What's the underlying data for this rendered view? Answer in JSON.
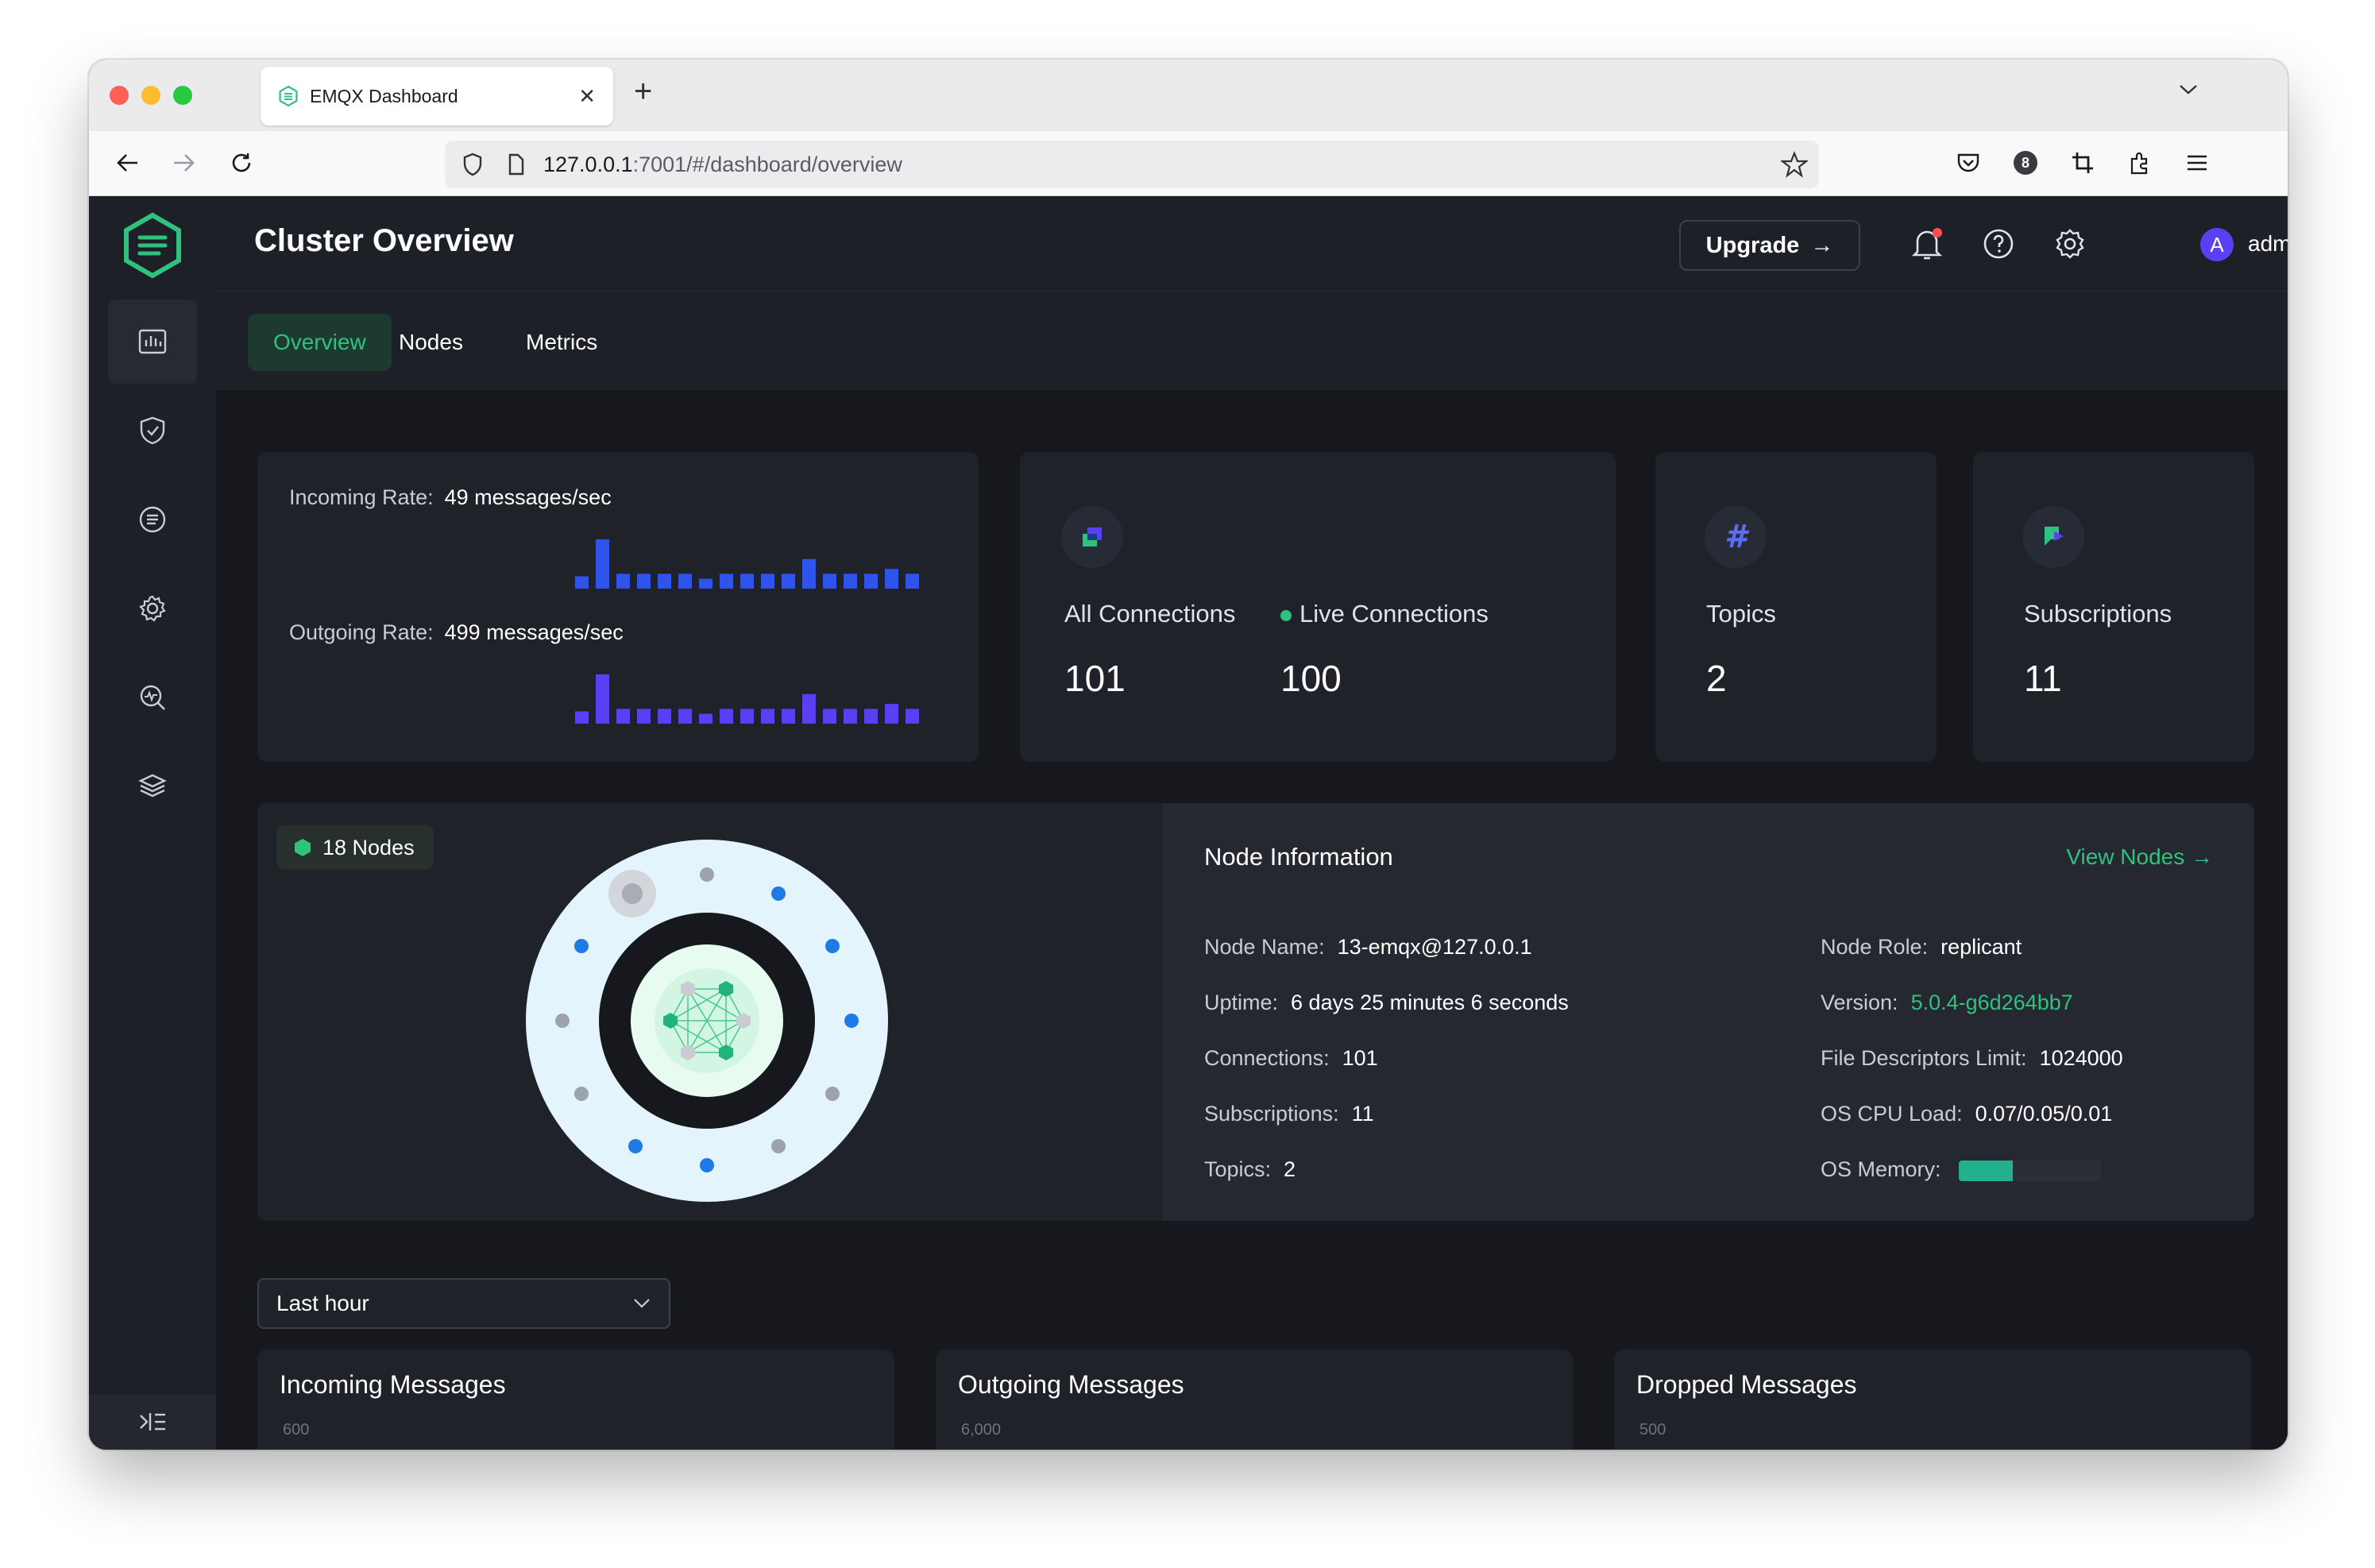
{
  "browser": {
    "tab_title": "EMQX Dashboard",
    "url_host": "127.0.0.1",
    "url_rest": ":7001/#/dashboard/overview",
    "extension_badge": "8"
  },
  "header": {
    "title": "Cluster Overview",
    "upgrade_label": "Upgrade",
    "user_initial": "A",
    "user_name": "admin"
  },
  "tabs": [
    {
      "label": "Overview",
      "active": true
    },
    {
      "label": "Nodes",
      "active": false
    },
    {
      "label": "Metrics",
      "active": false
    }
  ],
  "rates": {
    "incoming_label": "Incoming Rate:",
    "incoming_value": "49 messages/sec",
    "incoming_bars": [
      0.25,
      1.0,
      0.3,
      0.3,
      0.3,
      0.3,
      0.2,
      0.3,
      0.3,
      0.3,
      0.3,
      0.6,
      0.3,
      0.3,
      0.3,
      0.4,
      0.3
    ],
    "outgoing_label": "Outgoing Rate:",
    "outgoing_value": "499 messages/sec",
    "outgoing_bars": [
      0.25,
      1.0,
      0.3,
      0.3,
      0.3,
      0.3,
      0.2,
      0.3,
      0.3,
      0.3,
      0.3,
      0.6,
      0.3,
      0.3,
      0.3,
      0.4,
      0.3
    ],
    "incoming_color": "#2f54eb",
    "outgoing_color": "#5b3ff5"
  },
  "stats": {
    "all_connections_label": "All Connections",
    "all_connections_value": "101",
    "live_connections_label": "Live Connections",
    "live_connections_value": "100",
    "topics_label": "Topics",
    "topics_value": "2",
    "subscriptions_label": "Subscriptions",
    "subscriptions_value": "11"
  },
  "nodes": {
    "badge": "18 Nodes",
    "info_title": "Node Information",
    "view_nodes": "View Nodes",
    "left": [
      {
        "label": "Node Name:",
        "value": "13-emqx@127.0.0.1"
      },
      {
        "label": "Uptime:",
        "value": "6 days 25 minutes 6 seconds"
      },
      {
        "label": "Connections:",
        "value": "101"
      },
      {
        "label": "Subscriptions:",
        "value": "11"
      },
      {
        "label": "Topics:",
        "value": "2"
      }
    ],
    "right": [
      {
        "label": "Node Role:",
        "value": "replicant"
      },
      {
        "label": "Version:",
        "value": "5.0.4-g6d264bb7"
      },
      {
        "label": "File Descriptors Limit:",
        "value": "1024000"
      },
      {
        "label": "OS CPU Load:",
        "value": "0.07/0.05/0.01"
      },
      {
        "label": "OS Memory:",
        "value": ""
      }
    ],
    "os_memory_fraction": 0.38
  },
  "time_range": "Last hour",
  "charts": [
    {
      "title": "Incoming Messages",
      "first_tick": "600"
    },
    {
      "title": "Outgoing Messages",
      "first_tick": "6,000"
    },
    {
      "title": "Dropped Messages",
      "first_tick": "500"
    }
  ],
  "colors": {
    "accent": "#2ec27e",
    "background": "#16181d",
    "card": "#1f2229"
  }
}
